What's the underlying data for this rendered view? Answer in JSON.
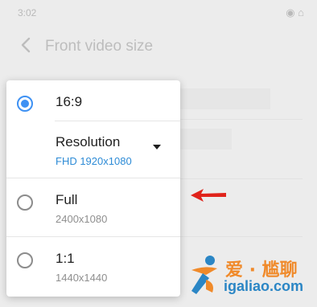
{
  "status_bar": {
    "time": "3:02",
    "icons": "◉ ⌂"
  },
  "header": {
    "back_icon": "chevron-left",
    "title": "Front video size"
  },
  "popup": {
    "options": [
      {
        "label": "16:9",
        "selected": true
      },
      {
        "label": "Full",
        "detail": "2400x1080",
        "selected": false
      },
      {
        "label": "1:1",
        "detail": "1440x1440",
        "selected": false
      }
    ],
    "resolution": {
      "label": "Resolution",
      "value": "FHD 1920x1080"
    }
  },
  "colors": {
    "accent": "#3e91f3",
    "resolution_value": "#2d8bd6",
    "arrow": "#e0231b"
  },
  "watermark": {
    "title": "爱 · 尴聊",
    "url": "igaliao.com"
  }
}
